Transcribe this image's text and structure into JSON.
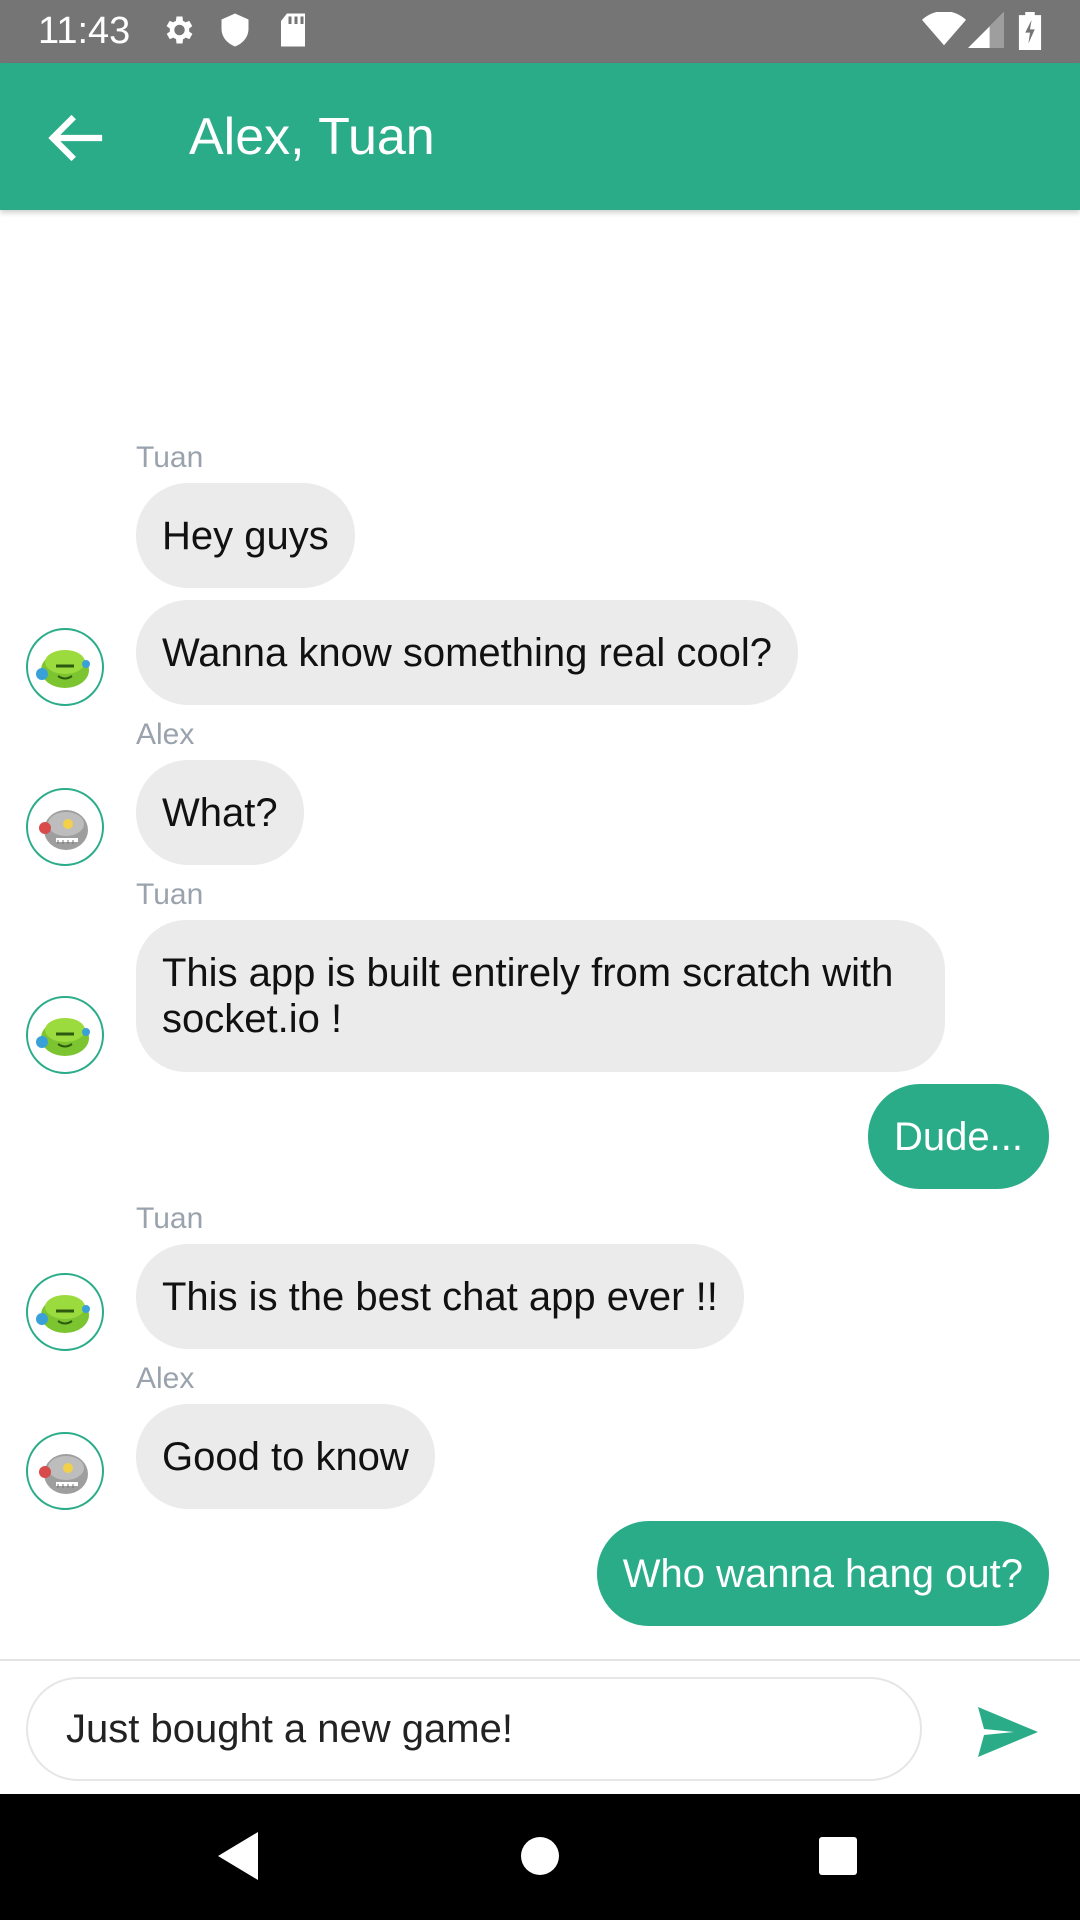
{
  "status_bar": {
    "time": "11:43",
    "icons": [
      "settings-icon",
      "shield-icon",
      "sd-card-icon",
      "wifi-icon",
      "signal-icon",
      "battery-icon"
    ]
  },
  "header": {
    "title": "Alex, Tuan",
    "back_icon": "arrow-back-icon",
    "background": "#2bac88"
  },
  "messages": [
    {
      "sender": "Tuan",
      "text": "Hey guys",
      "mine": false
    },
    {
      "sender": "",
      "text": "Wanna know something real cool?",
      "mine": false,
      "avatar": "tuan"
    },
    {
      "sender": "Alex",
      "text": "What?",
      "mine": false,
      "avatar": "alex"
    },
    {
      "sender": "Tuan",
      "text": "This app is built entirely from scratch with socket.io !",
      "mine": false,
      "avatar": "tuan"
    },
    {
      "sender": "",
      "text": "Dude...",
      "mine": true
    },
    {
      "sender": "Tuan",
      "text": "This is the best chat app ever !!",
      "mine": false,
      "avatar": "tuan"
    },
    {
      "sender": "Alex",
      "text": "Good to know",
      "mine": false,
      "avatar": "alex"
    },
    {
      "sender": "",
      "text": "Who wanna hang out?",
      "mine": true
    }
  ],
  "composer": {
    "value": "Just bought a new game!",
    "send_icon": "send-icon"
  },
  "colors": {
    "accent": "#2bac88",
    "incoming_bubble": "#ebebeb",
    "sender_label": "#9aa3ad"
  },
  "nav_bar": {
    "icons": [
      "back-triangle-icon",
      "home-circle-icon",
      "recents-square-icon"
    ]
  }
}
